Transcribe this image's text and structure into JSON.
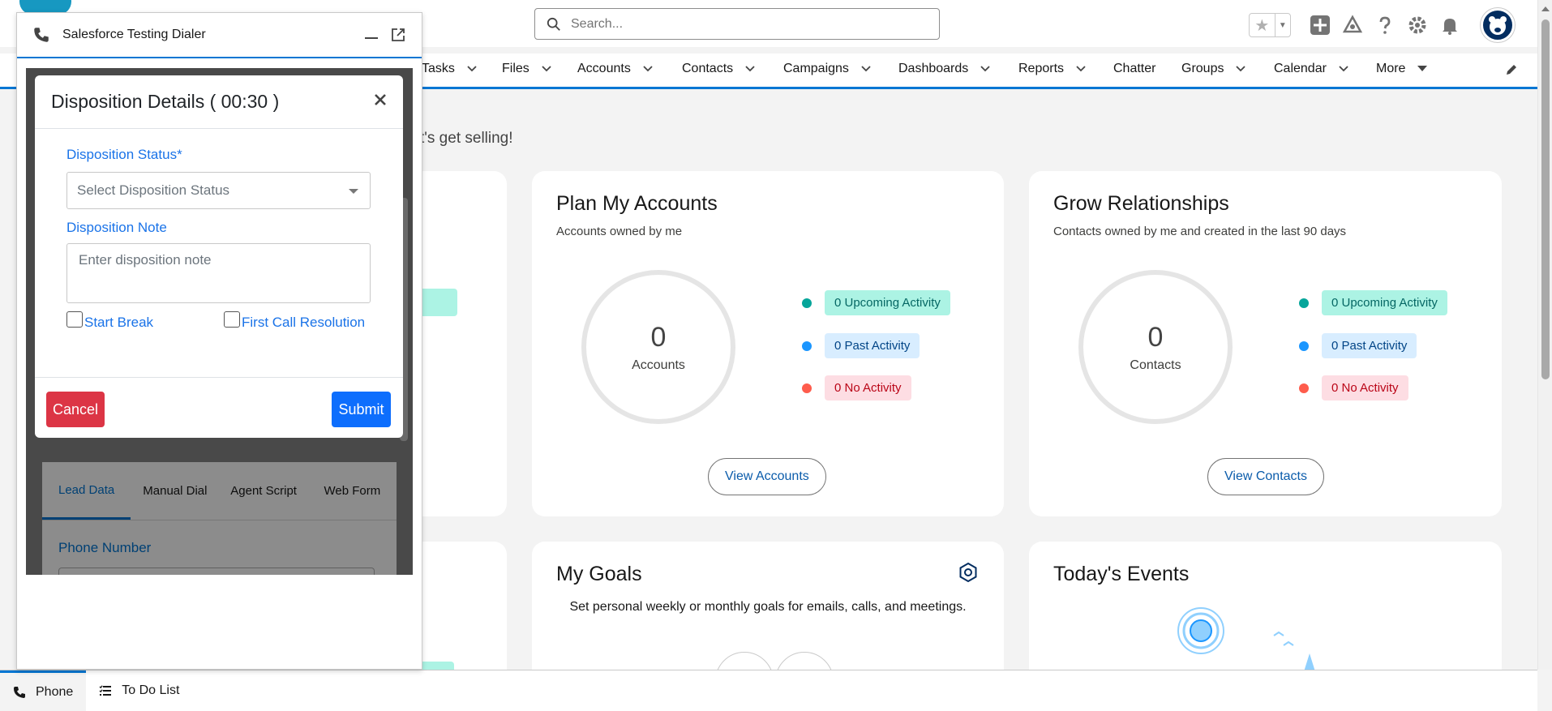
{
  "header": {
    "search_placeholder": "Search..."
  },
  "nav": {
    "items": [
      "Tasks",
      "Files",
      "Accounts",
      "Contacts",
      "Campaigns",
      "Dashboards",
      "Reports",
      "Chatter",
      "Groups",
      "Calendar",
      "More"
    ]
  },
  "home": {
    "greeting_partial": "t's get selling!",
    "plan_accounts": {
      "title": "Plan My Accounts",
      "subtitle": "Accounts owned by me",
      "count": "0",
      "count_label": "Accounts",
      "upcoming": "0 Upcoming Activity",
      "past": "0 Past Activity",
      "none": "0 No Activity",
      "button": "View Accounts"
    },
    "grow_relationships": {
      "title": "Grow Relationships",
      "subtitle": "Contacts owned by me and created in the last 90 days",
      "count": "0",
      "count_label": "Contacts",
      "upcoming": "0 Upcoming Activity",
      "past": "0 Past Activity",
      "none": "0 No Activity",
      "button": "View Contacts"
    },
    "my_goals": {
      "title": "My Goals",
      "text": "Set personal weekly or monthly goals for emails, calls, and meetings."
    },
    "todays_events": {
      "title": "Today's Events"
    },
    "colors": {
      "upcoming_dot": "#06a59a",
      "past_dot": "#1b96ff",
      "none_dot": "#fe5c4c"
    }
  },
  "dialer": {
    "title": "Salesforce Testing Dialer",
    "tabs": [
      "Lead Data",
      "Manual Dial",
      "Agent Script",
      "Web Form"
    ],
    "phone_label": "Phone Number"
  },
  "modal": {
    "title": "Disposition Details ( 00:30 )",
    "status_label": "Disposition Status*",
    "status_placeholder": "Select Disposition Status",
    "note_label": "Disposition Note",
    "note_placeholder": "Enter disposition note",
    "start_break": "Start Break",
    "first_call_resolution": "First Call Resolution",
    "cancel": "Cancel",
    "submit": "Submit"
  },
  "utility": {
    "phone": "Phone",
    "todo": "To Do List"
  }
}
